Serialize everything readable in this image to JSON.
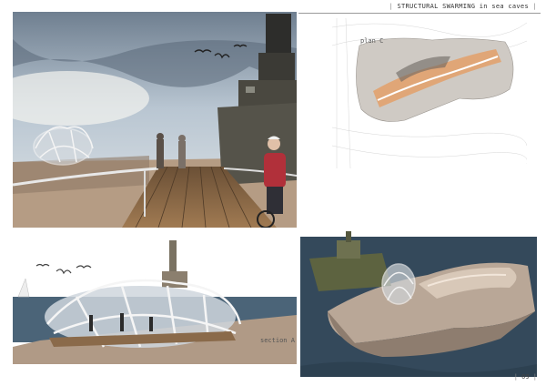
{
  "sheet": {
    "title": "STRUCTURAL SWARMING in sea caves",
    "page_number": "09"
  },
  "panels": {
    "plan_label": "plan C",
    "section_label": "section A"
  },
  "colors": {
    "sky": "#9fb0c2",
    "sea": "#3c5366",
    "deck_wood": "#8a6a4a",
    "rock": "#b8a89a",
    "structure": "#e8ecef",
    "plan_highlight": "#e3a06a"
  }
}
